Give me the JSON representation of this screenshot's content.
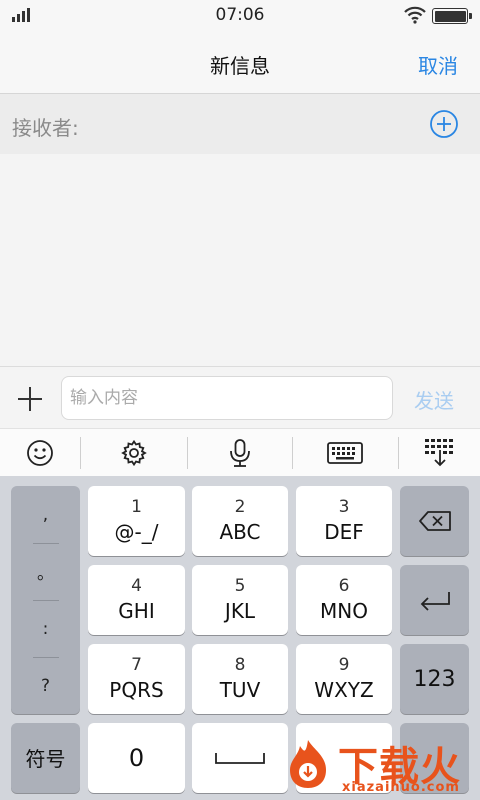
{
  "status_bar": {
    "time": "07:06"
  },
  "nav": {
    "title": "新信息",
    "cancel_label": "取消"
  },
  "recipient": {
    "label": "接收者:"
  },
  "compose": {
    "placeholder": "输入内容",
    "send_label": "发送"
  },
  "keyboard": {
    "punctuation": [
      ",",
      "。",
      ":",
      "?"
    ],
    "keys": [
      {
        "num": "1",
        "letters": "@-_/"
      },
      {
        "num": "2",
        "letters": "ABC"
      },
      {
        "num": "3",
        "letters": "DEF"
      },
      {
        "num": "4",
        "letters": "GHI"
      },
      {
        "num": "5",
        "letters": "JKL"
      },
      {
        "num": "6",
        "letters": "MNO"
      },
      {
        "num": "7",
        "letters": "PQRS"
      },
      {
        "num": "8",
        "letters": "TUV"
      },
      {
        "num": "9",
        "letters": "WXYZ"
      }
    ],
    "symbols_label": "符号",
    "zero_label": "0",
    "numbers_label": "123"
  },
  "watermark": {
    "cn": "下载火",
    "en": "xiazaihuo.com"
  },
  "colors": {
    "accent": "#2a86e3",
    "send_disabled": "#a9cdf1",
    "watermark": "#e8531c"
  }
}
